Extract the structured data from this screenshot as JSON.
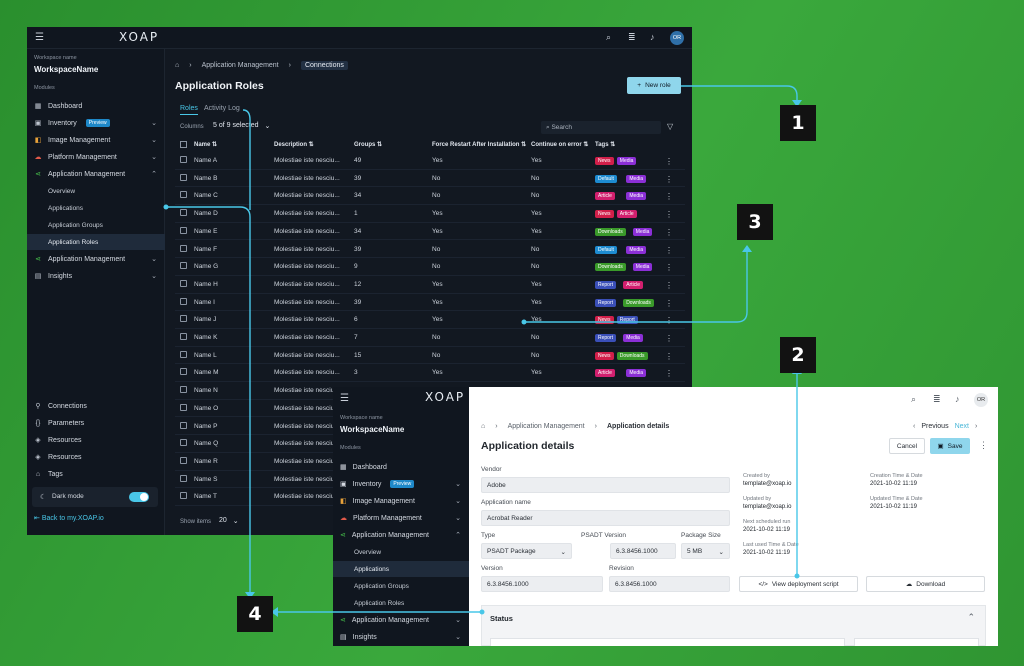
{
  "dark": {
    "logo": "XOAP",
    "workspace_label": "Workspace name",
    "workspace_name": "WorkspaceName",
    "modules_label": "Modules",
    "avatar": "OR",
    "nav": [
      {
        "label": "Dashboard"
      },
      {
        "label": "Inventory",
        "badge": "Preview"
      },
      {
        "label": "Image Management"
      },
      {
        "label": "Platform Management"
      },
      {
        "label": "Application Management"
      }
    ],
    "subnav": [
      "Overview",
      "Applications",
      "Application Groups",
      "Application Roles"
    ],
    "nav2": [
      {
        "label": "Application Management"
      },
      {
        "label": "Insights"
      }
    ],
    "bottom_nav": [
      "Connections",
      "Parameters",
      "Resources",
      "Resources",
      "Tags"
    ],
    "dark_mode": "Dark mode",
    "back_link": "Back to my.XOAP.io",
    "breadcrumb": [
      "Application Management",
      "Connections"
    ],
    "page_title": "Application Roles",
    "new_role": "New role",
    "tabs": [
      "Roles",
      "Activity Log"
    ],
    "columns_label": "Columns",
    "columns_value": "5 of 9 selected",
    "search_placeholder": "Search",
    "headers": [
      "Name",
      "Description",
      "Groups",
      "Force Restart After Installation",
      "Continue on error",
      "Tags"
    ],
    "rows": [
      {
        "name": "Name A",
        "desc": "Molestiae iste nesciu...",
        "groups": "49",
        "force": "Yes",
        "cont": "Yes",
        "tags": [
          {
            "t": "News",
            "c": "#d21f4a"
          },
          {
            "t": "Media",
            "c": "#8b2fd6"
          }
        ]
      },
      {
        "name": "Name B",
        "desc": "Molestiae iste nesciu...",
        "groups": "39",
        "force": "No",
        "cont": "No",
        "tags": [
          {
            "t": "Default",
            "c": "#1d8bd1"
          },
          {
            "t": "Media",
            "c": "#8b2fd6"
          }
        ]
      },
      {
        "name": "Name C",
        "desc": "Molestiae iste nesciu...",
        "groups": "34",
        "force": "No",
        "cont": "No",
        "tags": [
          {
            "t": "Article",
            "c": "#d21f6e"
          },
          {
            "t": "Media",
            "c": "#8b2fd6"
          }
        ]
      },
      {
        "name": "Name D",
        "desc": "Molestiae iste nesciu...",
        "groups": "1",
        "force": "Yes",
        "cont": "Yes",
        "tags": [
          {
            "t": "News",
            "c": "#d21f4a"
          },
          {
            "t": "Article",
            "c": "#d21f6e"
          }
        ]
      },
      {
        "name": "Name E",
        "desc": "Molestiae iste nesciu...",
        "groups": "34",
        "force": "Yes",
        "cont": "Yes",
        "tags": [
          {
            "t": "Downloads",
            "c": "#3a9a2a"
          },
          {
            "t": "Media",
            "c": "#8b2fd6"
          }
        ]
      },
      {
        "name": "Name F",
        "desc": "Molestiae iste nesciu...",
        "groups": "39",
        "force": "No",
        "cont": "No",
        "tags": [
          {
            "t": "Default",
            "c": "#1d8bd1"
          },
          {
            "t": "Media",
            "c": "#8b2fd6"
          }
        ]
      },
      {
        "name": "Name G",
        "desc": "Molestiae iste nesciu...",
        "groups": "9",
        "force": "No",
        "cont": "No",
        "tags": [
          {
            "t": "Downloads",
            "c": "#3a9a2a"
          },
          {
            "t": "Media",
            "c": "#8b2fd6"
          }
        ]
      },
      {
        "name": "Name H",
        "desc": "Molestiae iste nesciu...",
        "groups": "12",
        "force": "Yes",
        "cont": "Yes",
        "tags": [
          {
            "t": "Report",
            "c": "#3a4fb8"
          },
          {
            "t": "Article",
            "c": "#d21f6e"
          }
        ]
      },
      {
        "name": "Name I",
        "desc": "Molestiae iste nesciu...",
        "groups": "39",
        "force": "Yes",
        "cont": "Yes",
        "tags": [
          {
            "t": "Report",
            "c": "#3a4fb8"
          },
          {
            "t": "Downloads",
            "c": "#3a9a2a"
          }
        ]
      },
      {
        "name": "Name J",
        "desc": "Molestiae iste nesciu...",
        "groups": "6",
        "force": "Yes",
        "cont": "Yes",
        "tags": [
          {
            "t": "News",
            "c": "#d21f4a"
          },
          {
            "t": "Report",
            "c": "#3a4fb8"
          }
        ]
      },
      {
        "name": "Name K",
        "desc": "Molestiae iste nesciu...",
        "groups": "7",
        "force": "No",
        "cont": "No",
        "tags": [
          {
            "t": "Report",
            "c": "#3a4fb8"
          },
          {
            "t": "Media",
            "c": "#8b2fd6"
          }
        ]
      },
      {
        "name": "Name L",
        "desc": "Molestiae iste nesciu...",
        "groups": "15",
        "force": "No",
        "cont": "No",
        "tags": [
          {
            "t": "News",
            "c": "#d21f4a"
          },
          {
            "t": "Downloads",
            "c": "#3a9a2a"
          }
        ]
      },
      {
        "name": "Name M",
        "desc": "Molestiae iste nesciu...",
        "groups": "3",
        "force": "Yes",
        "cont": "Yes",
        "tags": [
          {
            "t": "Article",
            "c": "#d21f6e"
          },
          {
            "t": "Media",
            "c": "#8b2fd6"
          }
        ]
      },
      {
        "name": "Name N",
        "desc": "Molestiae iste nesciu..."
      },
      {
        "name": "Name O",
        "desc": "Molestiae iste nesciu..."
      },
      {
        "name": "Name P",
        "desc": "Molestiae iste nesciu..."
      },
      {
        "name": "Name Q",
        "desc": "Molestiae iste nesciu..."
      },
      {
        "name": "Name R",
        "desc": "Molestiae iste nesciu..."
      },
      {
        "name": "Name S",
        "desc": "Molestiae iste nesciu..."
      },
      {
        "name": "Name T",
        "desc": "Molestiae iste nesciu..."
      }
    ],
    "show_items_label": "Show items",
    "show_items_value": "20"
  },
  "light": {
    "logo": "XOAP",
    "workspace_label": "Workspace name",
    "workspace_name": "WorkspaceName",
    "modules_label": "Modules",
    "avatar": "OR",
    "nav": [
      {
        "label": "Dashboard"
      },
      {
        "label": "Inventory",
        "badge": "Preview"
      },
      {
        "label": "Image Management"
      },
      {
        "label": "Platform Management"
      },
      {
        "label": "Application Management"
      }
    ],
    "subnav": [
      "Overview",
      "Applications",
      "Application Groups",
      "Application Roles"
    ],
    "nav2": [
      {
        "label": "Application Management"
      },
      {
        "label": "Insights"
      }
    ],
    "breadcrumb": [
      "Application Management",
      "Application details"
    ],
    "previous": "Previous",
    "next": "Next",
    "title": "Application details",
    "cancel": "Cancel",
    "save": "Save",
    "vendor_label": "Vendor",
    "vendor": "Adobe",
    "appname_label": "Application name",
    "appname": "Acrobat Reader",
    "type_label": "Type",
    "type": "PSADT Package",
    "psadt_label": "PSADT Version",
    "psadt": "6.3.8456.1000",
    "pkgsize_label": "Package Size",
    "pkgsize": "5 MB",
    "version_label": "Version",
    "version": "6.3.8456.1000",
    "revision_label": "Revision",
    "revision": "6.3.8456.1000",
    "created_by_label": "Created by",
    "created_by": "template@xoap.io",
    "updated_by_label": "Updated by",
    "updated_by": "template@xoap.io",
    "next_run_label": "Next scheduled run",
    "next_run": "2021-10-02 11:19",
    "last_used_label": "Last used Time & Date",
    "last_used": "2021-10-02 11:19",
    "creation_label": "Creation Time & Date",
    "creation": "2021-10-02 11:19",
    "updated_label": "Updated Time & Date",
    "updated": "2021-10-02 11:19",
    "view_script": "View deployment script",
    "download": "Download",
    "status": "Status"
  },
  "callouts": [
    "1",
    "2",
    "3",
    "4"
  ],
  "colors": {
    "accent": "#49c7e8",
    "bg": "#2f9532"
  }
}
